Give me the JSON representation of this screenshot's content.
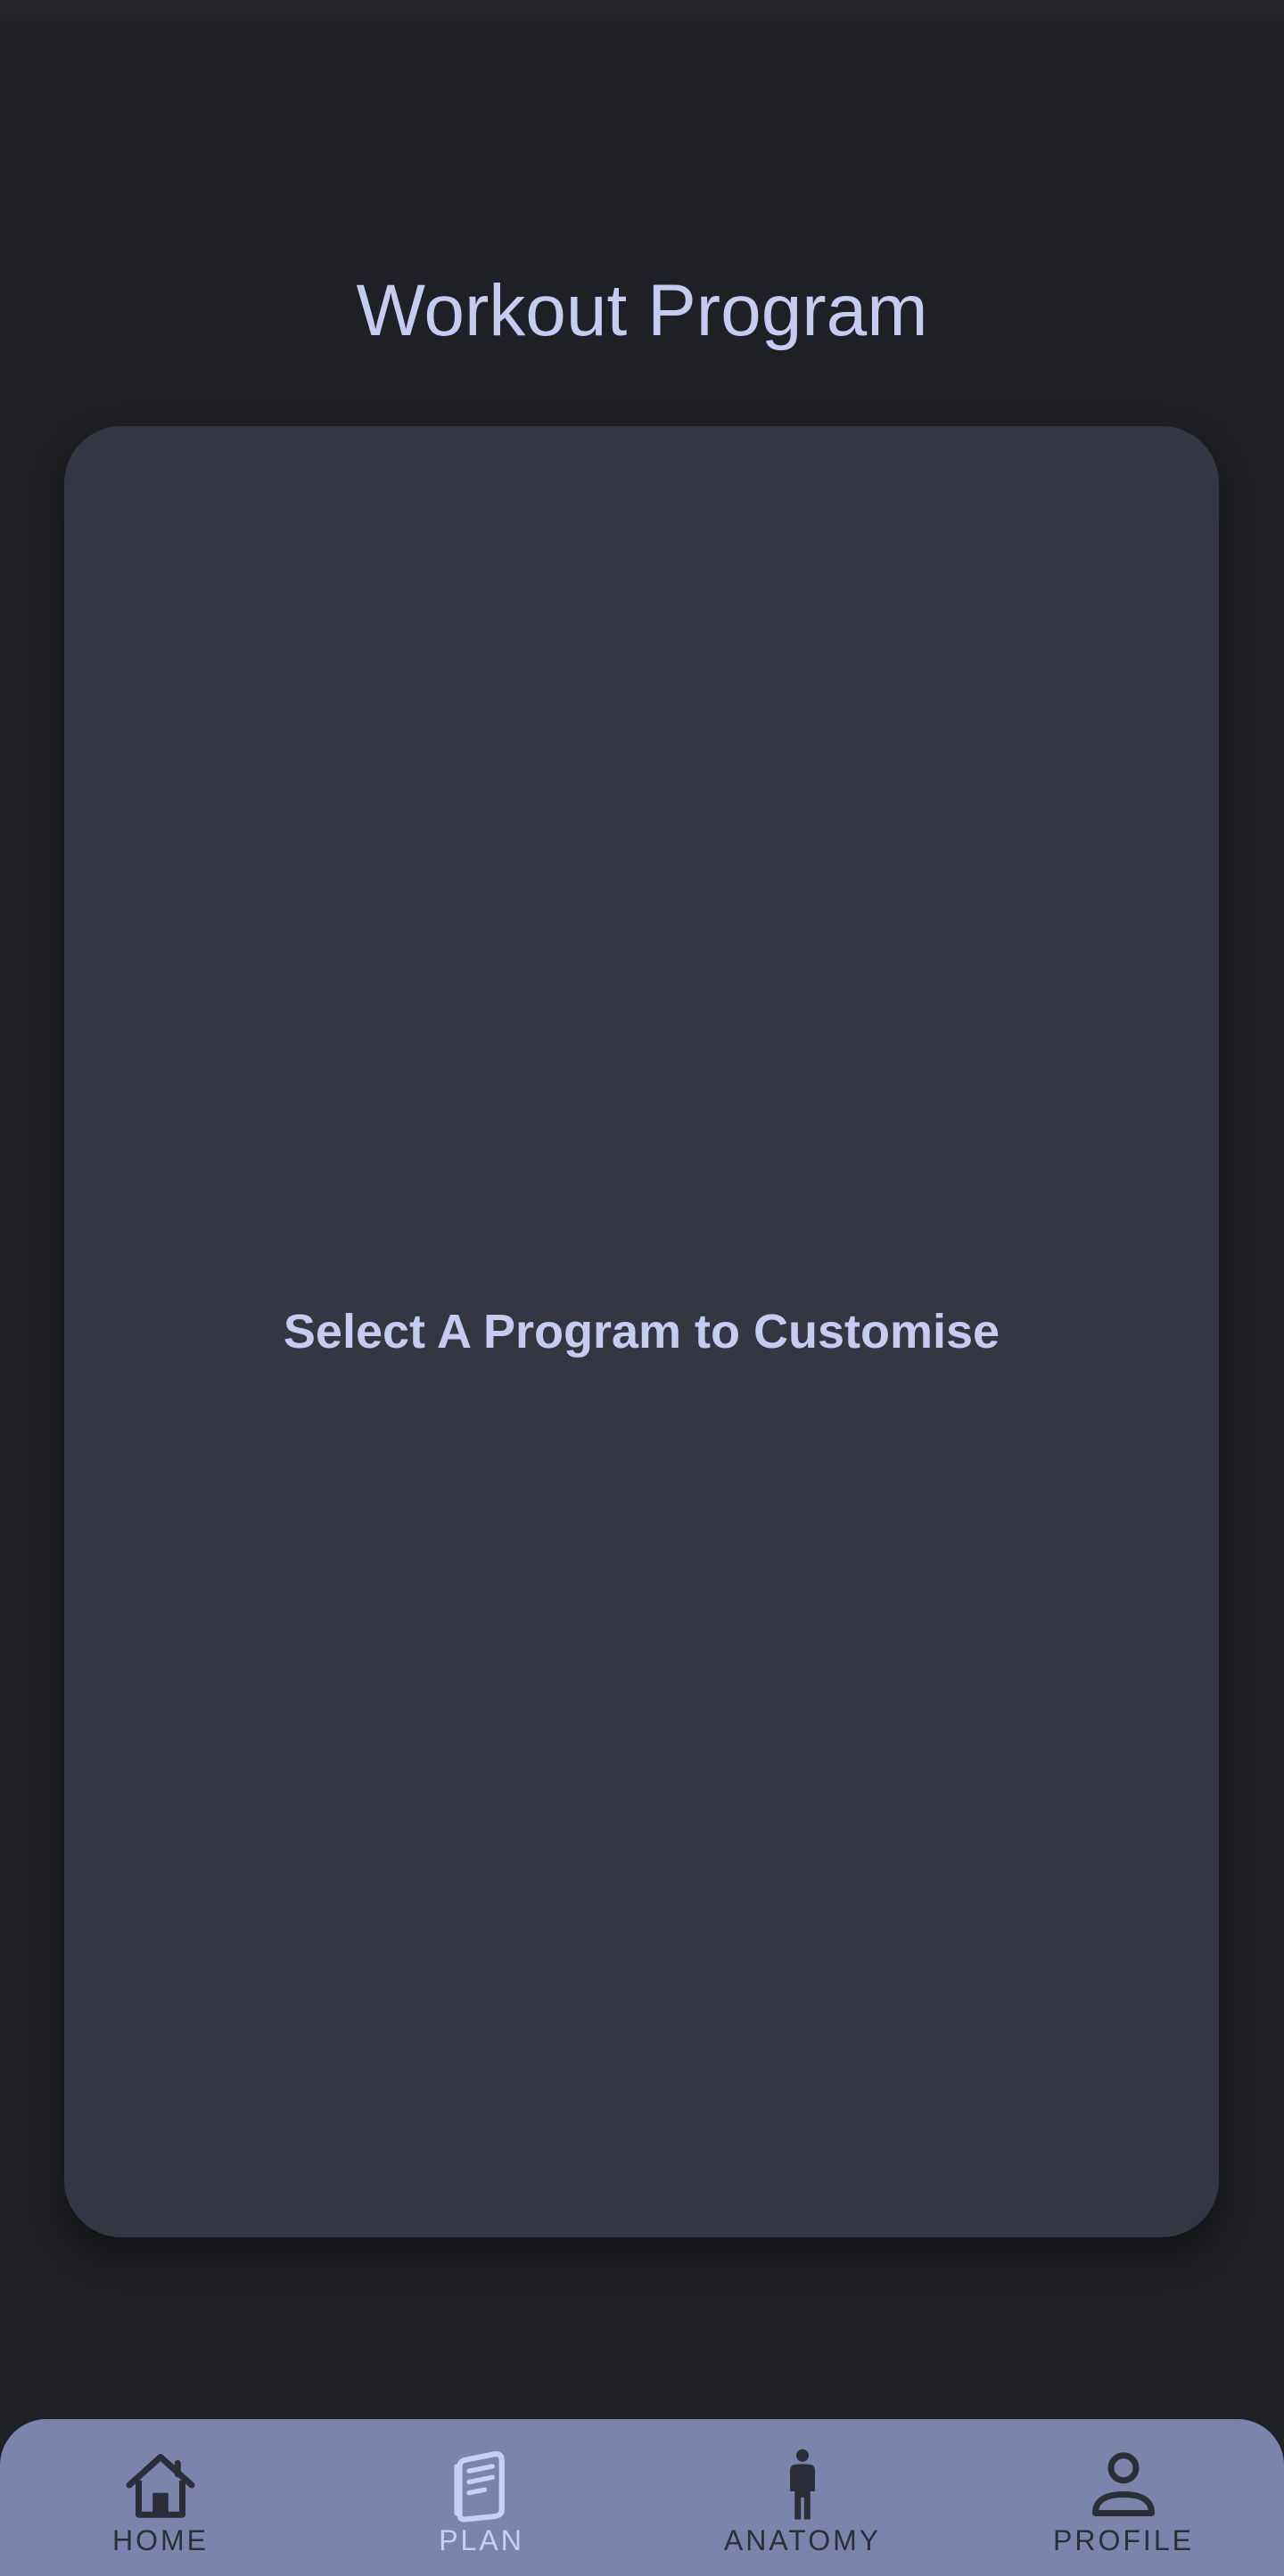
{
  "page": {
    "title": "Workout Program"
  },
  "card": {
    "message": "Select A Program to Customise"
  },
  "nav": {
    "items": [
      {
        "label": "HOME",
        "icon": "home-icon",
        "active": false
      },
      {
        "label": "PLAN",
        "icon": "document-icon",
        "active": true
      },
      {
        "label": "ANATOMY",
        "icon": "person-figure-icon",
        "active": false
      },
      {
        "label": "PROFILE",
        "icon": "user-icon",
        "active": false
      }
    ]
  },
  "colors": {
    "background": "#1f2025",
    "card": "#343641",
    "accent_text": "#c6cbf1",
    "nav_bar": "#7c84ac",
    "nav_inactive": "#2b2d38",
    "nav_active": "#cbd0f3"
  }
}
